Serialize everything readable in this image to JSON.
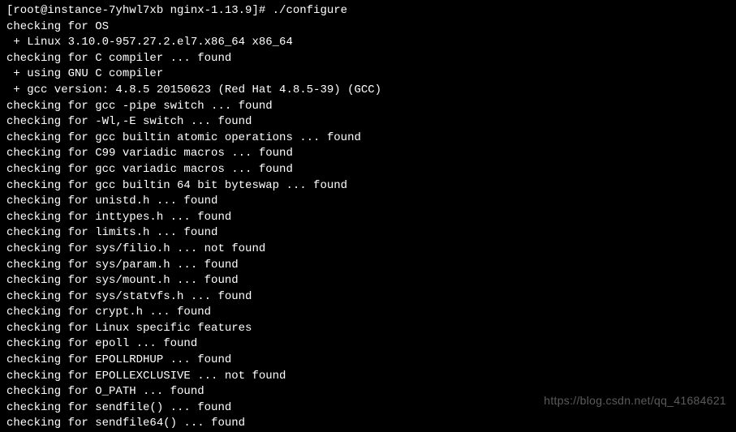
{
  "terminal": {
    "lines": [
      "[root@instance-7yhwl7xb nginx-1.13.9]# ./configure",
      "checking for OS",
      " + Linux 3.10.0-957.27.2.el7.x86_64 x86_64",
      "checking for C compiler ... found",
      " + using GNU C compiler",
      " + gcc version: 4.8.5 20150623 (Red Hat 4.8.5-39) (GCC)",
      "checking for gcc -pipe switch ... found",
      "checking for -Wl,-E switch ... found",
      "checking for gcc builtin atomic operations ... found",
      "checking for C99 variadic macros ... found",
      "checking for gcc variadic macros ... found",
      "checking for gcc builtin 64 bit byteswap ... found",
      "checking for unistd.h ... found",
      "checking for inttypes.h ... found",
      "checking for limits.h ... found",
      "checking for sys/filio.h ... not found",
      "checking for sys/param.h ... found",
      "checking for sys/mount.h ... found",
      "checking for sys/statvfs.h ... found",
      "checking for crypt.h ... found",
      "checking for Linux specific features",
      "checking for epoll ... found",
      "checking for EPOLLRDHUP ... found",
      "checking for EPOLLEXCLUSIVE ... not found",
      "checking for O_PATH ... found",
      "checking for sendfile() ... found",
      "checking for sendfile64() ... found"
    ]
  },
  "watermark": "https://blog.csdn.net/qq_41684621"
}
